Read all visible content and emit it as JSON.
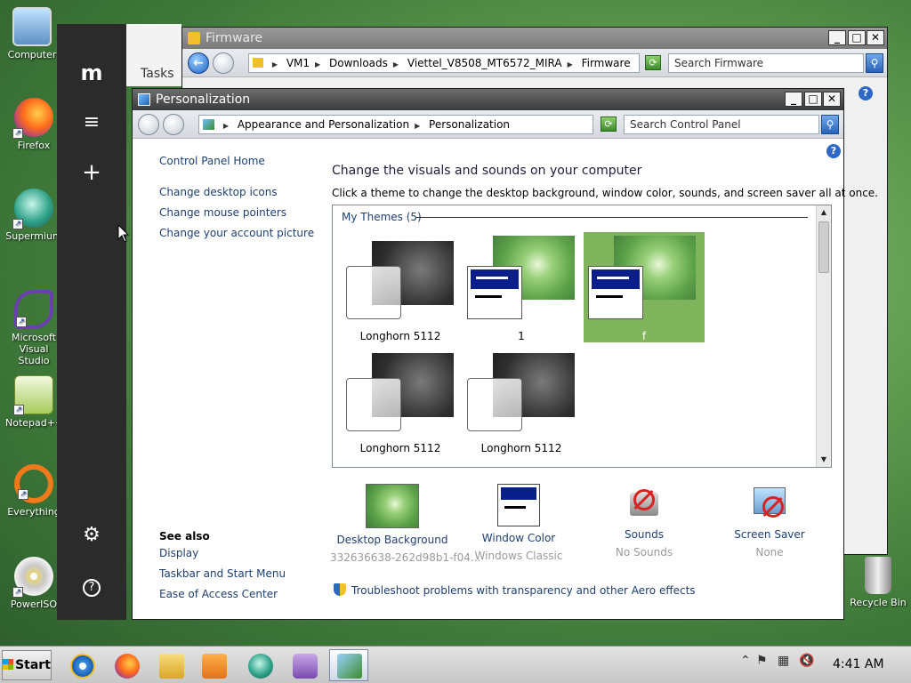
{
  "desktop": {
    "icons": [
      {
        "label": "Computer"
      },
      {
        "label": "Firefox"
      },
      {
        "label": "Supermium"
      },
      {
        "label": "Microsoft Visual Studio"
      },
      {
        "label": "Notepad++"
      },
      {
        "label": "Everything"
      },
      {
        "label": "PowerISO"
      },
      {
        "label": "Recycle Bin"
      }
    ]
  },
  "sidebar": {
    "logo": "m",
    "menu_glyph": "≡",
    "add_glyph": "+",
    "settings_glyph": "⚙",
    "help_glyph": "?",
    "tasks_label": "Tasks"
  },
  "firmware_window": {
    "title": "Firmware",
    "path": [
      "VM1",
      "Downloads",
      "Viettel_V8508_MT6572_MIRA",
      "Firmware"
    ],
    "search_placeholder": "Search Firmware"
  },
  "personalization_window": {
    "title": "Personalization",
    "path": [
      "Appearance and Personalization",
      "Personalization"
    ],
    "search_placeholder": "Search Control Panel",
    "left_links": {
      "home": "Control Panel Home",
      "desktop_icons": "Change desktop icons",
      "mouse_pointers": "Change mouse pointers",
      "account_picture": "Change your account picture"
    },
    "see_also": {
      "heading": "See also",
      "items": [
        "Display",
        "Taskbar and Start Menu",
        "Ease of Access Center"
      ]
    },
    "heading": "Change the visuals and sounds on your computer",
    "subheading": "Click a theme to change the desktop background, window color, sounds, and screen saver all at once.",
    "themes_group": "My Themes (5)",
    "themes": [
      {
        "name": "Longhorn 5112",
        "selected": false
      },
      {
        "name": "1",
        "selected": false
      },
      {
        "name": "f",
        "selected": true
      },
      {
        "name": "Longhorn 5112",
        "selected": false
      },
      {
        "name": "Longhorn 5112",
        "selected": false
      }
    ],
    "options": [
      {
        "title": "Desktop Background",
        "value": "332636638-262d98b1-f04..."
      },
      {
        "title": "Window Color",
        "value": "Windows Classic"
      },
      {
        "title": "Sounds",
        "value": "No Sounds"
      },
      {
        "title": "Screen Saver",
        "value": "None"
      }
    ],
    "troubleshoot": "Troubleshoot problems with transparency and other Aero effects"
  },
  "taskbar": {
    "start_label": "Start",
    "clock": "4:41 AM"
  }
}
